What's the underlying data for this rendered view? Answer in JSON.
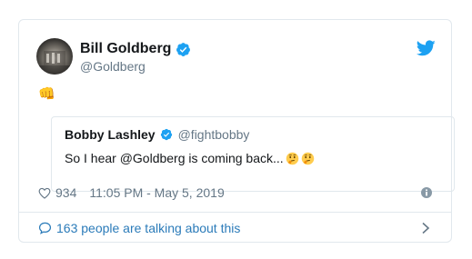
{
  "tweet": {
    "display_name": "Bill Goldberg",
    "handle": "@Goldberg",
    "body_emoji": "👊",
    "likes": "934",
    "timestamp": "11:05 PM - May 5, 2019",
    "talking": "163 people are talking about this"
  },
  "quoted": {
    "display_name": "Bobby Lashley",
    "handle": "@fightbobby",
    "text": "So I hear @Goldberg is coming back..."
  },
  "colors": {
    "twitter_blue": "#1da1f2",
    "link_blue": "#2b7bb9",
    "secondary_text": "#657786",
    "border": "#e1e8ed"
  },
  "icons": [
    "verified-icon",
    "twitter-logo-icon",
    "fist-emoji-icon",
    "thinking-emoji-icon",
    "heart-icon",
    "info-icon",
    "speech-bubble-icon",
    "chevron-right-icon"
  ]
}
